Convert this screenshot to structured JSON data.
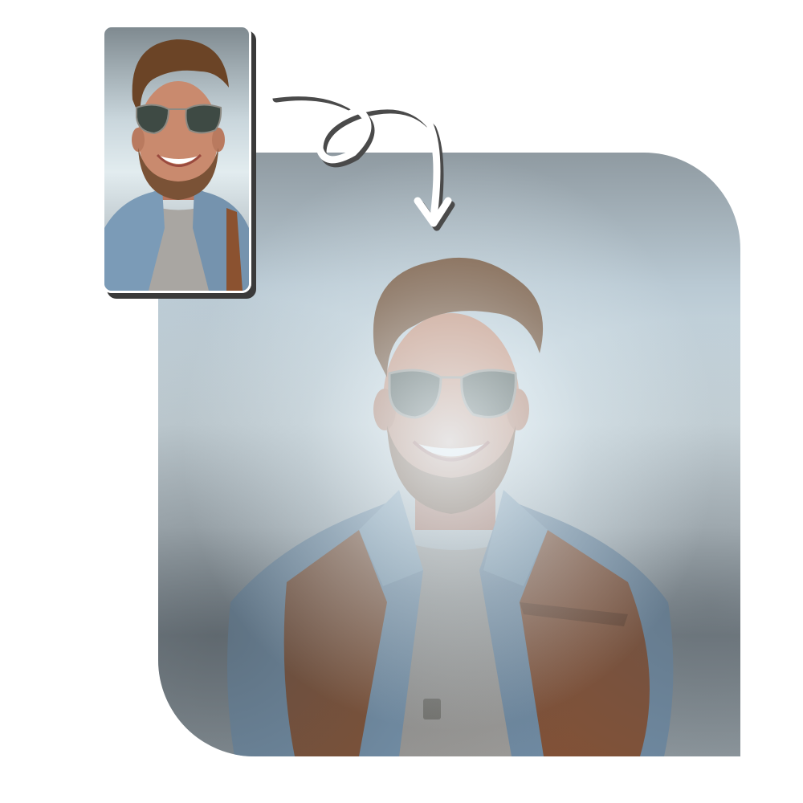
{
  "scene": {
    "description_colors": {
      "background": "#ffffff",
      "frame_border": "#ffffff",
      "frame_shadow": "#3a3a3a",
      "arrow": "#ffffff",
      "arrow_shadow": "#4a4a4a",
      "hair": "#6b4426",
      "skin": "#c98a6e",
      "denim": "#7b9bb7",
      "leather": "#8b5230",
      "tshirt": "#a9a6a2",
      "lens": "#3e4a44"
    },
    "icons": [
      "swirl-arrow-icon"
    ]
  }
}
